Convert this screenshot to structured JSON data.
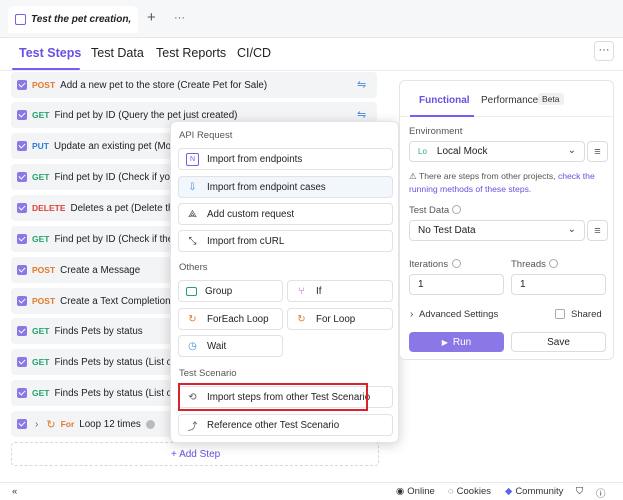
{
  "header": {
    "doc_title": "Test the pet creation,",
    "add_tab": "+",
    "more": "···"
  },
  "tabs": [
    "Test Steps",
    "Test Data",
    "Test Reports",
    "CI/CD"
  ],
  "tabs_more": "···",
  "steps": [
    {
      "method": "POST",
      "name": "Add a new pet to the store (Create Pet for Sale)"
    },
    {
      "method": "GET",
      "name": "Find pet by ID (Query the pet just created)"
    },
    {
      "method": "PUT",
      "name": "Update an existing pet (Modi"
    },
    {
      "method": "GET",
      "name": "Find pet by ID (Check if your"
    },
    {
      "method": "DELETE",
      "name": "Deletes a pet (Delete the"
    },
    {
      "method": "GET",
      "name": "Find pet by ID (Check if the c"
    },
    {
      "method": "POST",
      "name": "Create a Message"
    },
    {
      "method": "POST",
      "name": "Create a Text Completion"
    },
    {
      "method": "GET",
      "name": "Finds Pets by status"
    },
    {
      "method": "GET",
      "name": "Finds Pets by status (List of s"
    },
    {
      "method": "GET",
      "name": "Finds Pets by status (List of"
    }
  ],
  "loop_step": {
    "keyword": "For",
    "label": "Loop 12 times"
  },
  "add_step": "+ Add Step",
  "menu": {
    "api_section": "API Request",
    "import_endpoints": "Import from endpoints",
    "import_endpoint_cases": "Import from endpoint cases",
    "add_custom": "Add custom request",
    "import_curl": "Import from cURL",
    "others_section": "Others",
    "group": "Group",
    "if": "If",
    "foreach": "ForEach Loop",
    "for_loop": "For Loop",
    "wait": "Wait",
    "scenario_section": "Test Scenario",
    "import_steps": "Import steps from other Test Scenario",
    "reference_scenario": "Reference other Test Scenario"
  },
  "panel": {
    "tab_functional": "Functional",
    "tab_performance": "Performance",
    "beta": "Beta",
    "env_label": "Environment",
    "env_badge": "Lo",
    "env_value": "Local Mock",
    "notice_text": "There are steps from other projects,",
    "notice_link": "check the running methods of these steps.",
    "test_data_label": "Test Data",
    "test_data_value": "No Test Data",
    "iterations_label": "Iterations",
    "iterations_value": "1",
    "threads_label": "Threads",
    "threads_value": "1",
    "advanced": "Advanced Settings",
    "shared": "Shared",
    "run": "Run",
    "save": "Save"
  },
  "footer": {
    "collapse": "«",
    "online": "Online",
    "cookies": "Cookies",
    "community": "Community"
  },
  "colors": {
    "accent": "#7b5cf0",
    "highlight": "#d8232a",
    "post": "#e4792a",
    "get": "#23a26b",
    "put": "#2b7fd9",
    "delete": "#e0413a"
  }
}
